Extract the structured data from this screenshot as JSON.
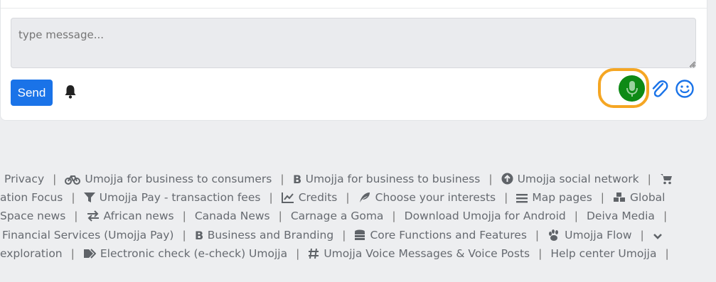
{
  "composer": {
    "placeholder": "type message...",
    "send_label": "Send"
  },
  "footer": {
    "rows": [
      [
        {
          "label": "Privacy",
          "icon": ""
        },
        {
          "label": "Umojja for business to consumers",
          "icon": "bicycle-icon"
        },
        {
          "label": "Umojja for business to business",
          "icon": "bold-b-icon"
        },
        {
          "label": "Umojja social network",
          "icon": "arrow-up-circle-icon"
        },
        {
          "label": "",
          "icon": "cart-icon"
        }
      ],
      [
        {
          "label": "ation Focus",
          "icon": ""
        },
        {
          "label": "Umojja Pay - transaction fees",
          "icon": "filter-icon"
        },
        {
          "label": "Credits",
          "icon": "chart-line-icon"
        },
        {
          "label": "Choose your interests",
          "icon": "feather-icon"
        },
        {
          "label": "Map pages",
          "icon": "bars-icon"
        },
        {
          "label": "Global",
          "icon": "cubes-icon"
        }
      ],
      [
        {
          "label": "Space news",
          "icon": ""
        },
        {
          "label": "African news",
          "icon": "exchange-icon"
        },
        {
          "label": "Canada News",
          "icon": ""
        },
        {
          "label": "Carnage a Goma",
          "icon": ""
        },
        {
          "label": "Download Umojja for Android",
          "icon": ""
        },
        {
          "label": "Deiva Media",
          "icon": ""
        }
      ],
      [
        {
          "label": "Financial Services (Umojja Pay)",
          "icon": ""
        },
        {
          "label": "Business and Branding",
          "icon": "bold-b-icon"
        },
        {
          "label": "Core Functions and Features",
          "icon": "coins-icon"
        },
        {
          "label": "Umojja Flow",
          "icon": "paw-icon"
        },
        {
          "label": "",
          "icon": "chevron-down-icon"
        }
      ],
      [
        {
          "label": "exploration",
          "icon": ""
        },
        {
          "label": "Electronic check (e-check) Umojja",
          "icon": "tag-icon"
        },
        {
          "label": "Umojja Voice Messages & Voice Posts",
          "icon": "hashtag-icon"
        },
        {
          "label": "Help center Umojja",
          "icon": ""
        }
      ]
    ]
  }
}
